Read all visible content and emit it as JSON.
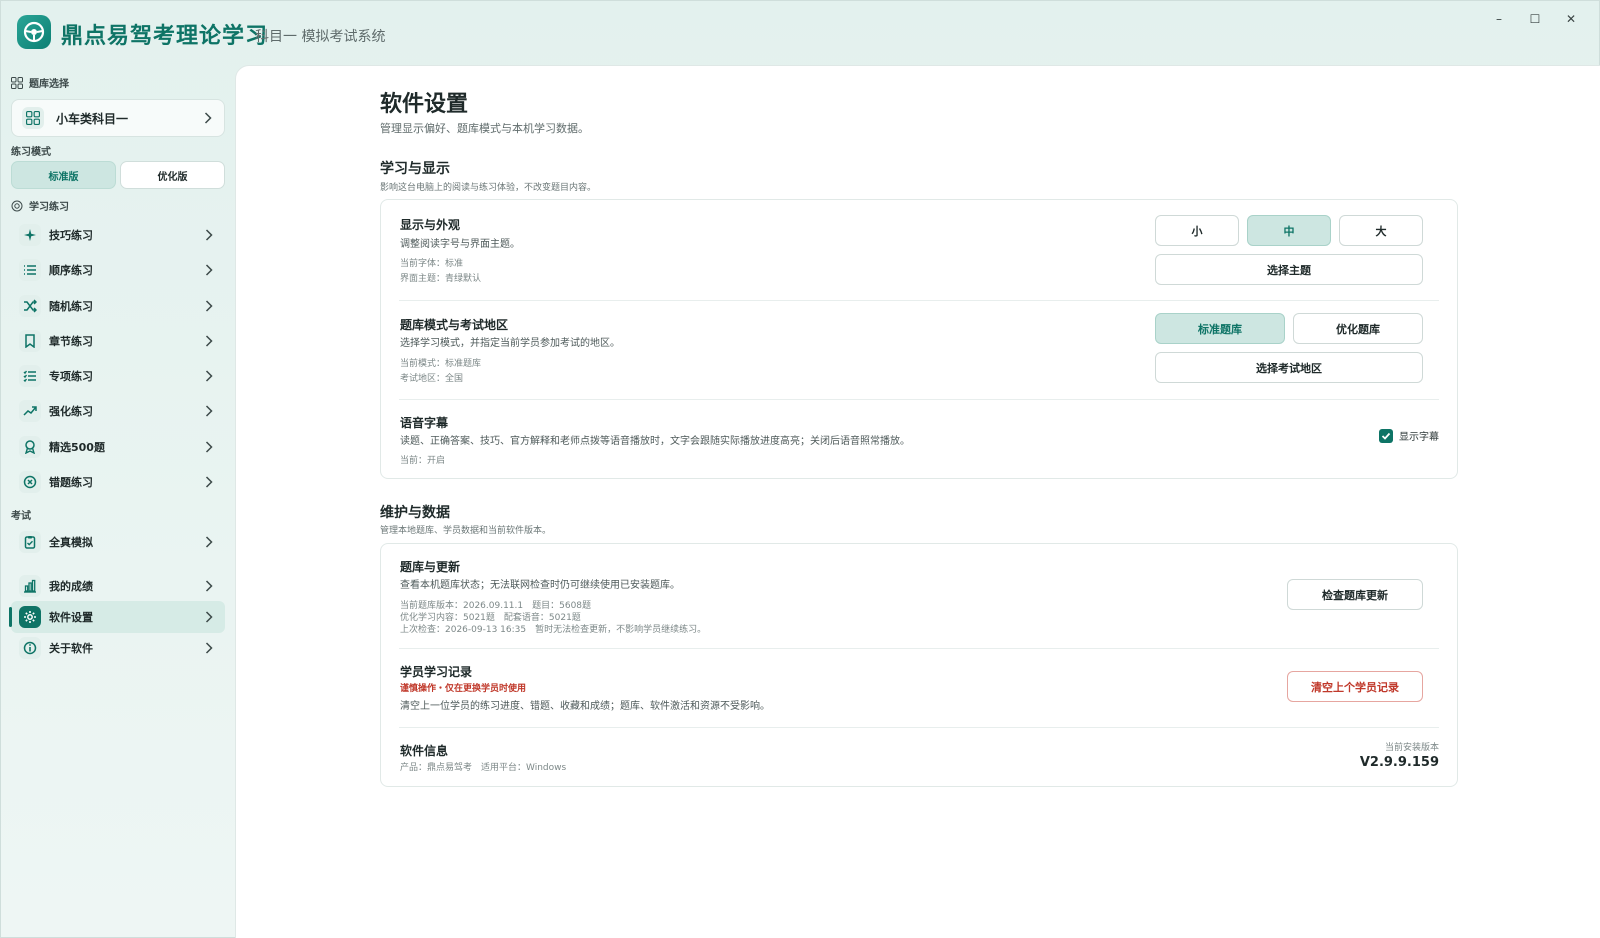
{
  "app": {
    "title": "鼎点易驾考理论学习",
    "subtitle": "科目一 模拟考试系统"
  },
  "window_controls": {
    "minimize": "–",
    "maximize": "☐",
    "close": "✕"
  },
  "sidebar": {
    "bank_section_title": "题库选择",
    "bank_value": "小车类科目一",
    "mode_section_title": "练习模式",
    "modes": [
      {
        "label": "标准版",
        "active": true
      },
      {
        "label": "优化版",
        "active": false
      }
    ],
    "practice_section_title": "学习练习",
    "practice_items": [
      {
        "label": "技巧练习",
        "icon": "sparkle-icon"
      },
      {
        "label": "顺序练习",
        "icon": "list-icon"
      },
      {
        "label": "随机练习",
        "icon": "shuffle-icon"
      },
      {
        "label": "章节练习",
        "icon": "bookmark-icon"
      },
      {
        "label": "专项练习",
        "icon": "checklist-icon"
      },
      {
        "label": "强化练习",
        "icon": "trend-up-icon"
      },
      {
        "label": "精选500题",
        "icon": "award-icon"
      },
      {
        "label": "错题练习",
        "icon": "x-circle-icon"
      }
    ],
    "exam_section_title": "考试",
    "exam_items": [
      {
        "label": "全真模拟",
        "icon": "clipboard-icon"
      }
    ],
    "other_items": [
      {
        "label": "我的成绩",
        "icon": "bar-chart-icon",
        "active": false
      },
      {
        "label": "软件设置",
        "icon": "gear-icon",
        "active": true
      },
      {
        "label": "关于软件",
        "icon": "info-icon",
        "active": false
      }
    ]
  },
  "main": {
    "title": "软件设置",
    "description": "管理显示偏好、题库模式与本机学习数据。",
    "section1": {
      "title": "学习与显示",
      "description": "影响这台电脑上的阅读与练习体验，不改变题目内容。",
      "display": {
        "title": "显示与外观",
        "description": "调整阅读字号与界面主题。",
        "meta1": "当前字体：标准",
        "meta2": "界面主题：青绿默认",
        "sizes": [
          {
            "label": "小",
            "active": false
          },
          {
            "label": "中",
            "active": true
          },
          {
            "label": "大",
            "active": false
          }
        ],
        "theme_button": "选择主题"
      },
      "bank_mode": {
        "title": "题库模式与考试地区",
        "description": "选择学习模式，并指定当前学员参加考试的地区。",
        "meta1": "当前模式：标准题库",
        "meta2": "考试地区：全国",
        "modes": [
          {
            "label": "标准题库",
            "active": true
          },
          {
            "label": "优化题库",
            "active": false
          }
        ],
        "region_button": "选择考试地区"
      },
      "subtitles": {
        "title": "语音字幕",
        "description": "读题、正确答案、技巧、官方解释和老师点拨等语音播放时，文字会跟随实际播放进度高亮；关闭后语音照常播放。",
        "meta": "当前：开启",
        "checkbox_label": "显示字幕",
        "checked": true
      }
    },
    "section2": {
      "title": "维护与数据",
      "description": "管理本地题库、学员数据和当前软件版本。",
      "update": {
        "title": "题库与更新",
        "description": "查看本机题库状态；无法联网检查时仍可继续使用已安装题库。",
        "meta1": "当前题库版本：2026.09.11.1　题目：5608题",
        "meta2": "优化学习内容：5021题　配套语音：5021题",
        "meta3": "上次检查：2026-09-13 16:35　暂时无法检查更新，不影响学员继续练习。",
        "button": "检查题库更新"
      },
      "records": {
        "title": "学员学习记录",
        "warning": "谨慎操作・仅在更换学员时使用",
        "description": "清空上一位学员的练习进度、错题、收藏和成绩；题库、软件激活和资源不受影响。",
        "button": "清空上个学员记录"
      },
      "info": {
        "title": "软件信息",
        "meta": "产品：鼎点易驾考　适用平台：Windows",
        "version_label": "当前安装版本",
        "version": "V2.9.9.159"
      }
    }
  },
  "colors": {
    "accent": "#0e7466",
    "accent_light": "#cde6e1",
    "danger": "#c0392b"
  }
}
